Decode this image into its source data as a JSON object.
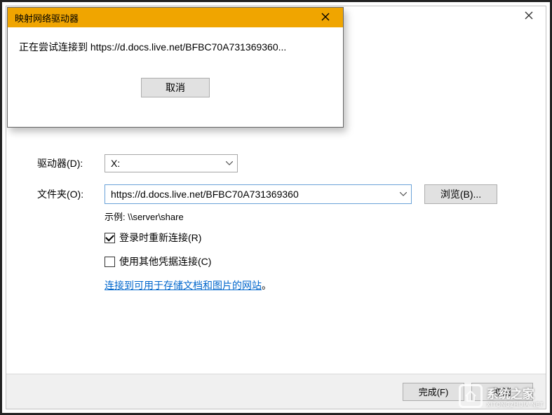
{
  "colors": {
    "accent": "#f0a500",
    "link": "#0066cc"
  },
  "wizard": {
    "drive": {
      "label": "驱动器(D):",
      "value": "X:"
    },
    "folder": {
      "label": "文件夹(O):",
      "value": "https://d.docs.live.net/BFBC70A731369360",
      "browse_label": "浏览(B)..."
    },
    "example": "示例: \\\\server\\share",
    "checkbox_reconnect": {
      "label": "登录时重新连接(R)",
      "checked": true
    },
    "checkbox_credentials": {
      "label": "使用其他凭据连接(C)",
      "checked": false
    },
    "link_text": "连接到可用于存储文档和图片的网站",
    "link_period": "。",
    "footer": {
      "finish": "完成(F)",
      "cancel": "取消"
    }
  },
  "modal": {
    "title": "映射网络驱动器",
    "message": "正在尝试连接到 https://d.docs.live.net/BFBC70A731369360...",
    "cancel_label": "取消"
  },
  "watermark": {
    "text": "系统之家",
    "sub": "XITONGZHIJIA.NET"
  }
}
